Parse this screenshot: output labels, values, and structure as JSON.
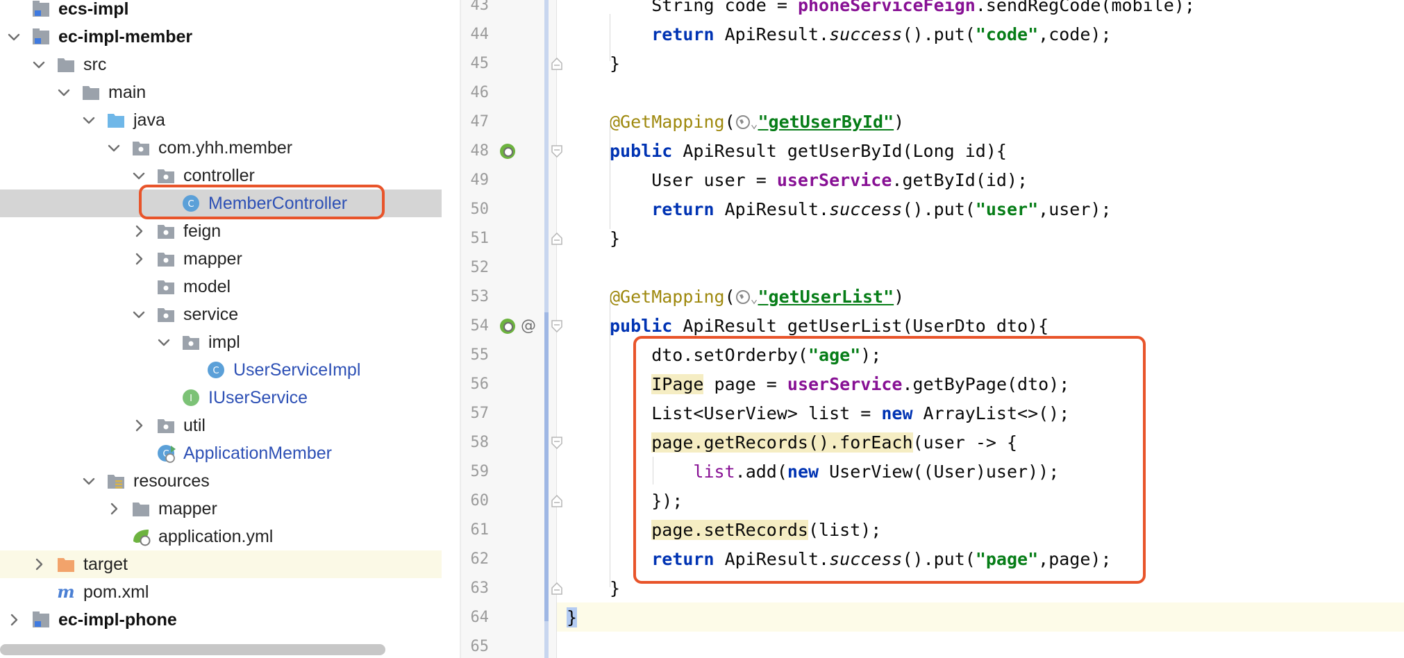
{
  "tree": {
    "items": [
      {
        "label": "ecs-impl",
        "style": "bold",
        "icon": "module-icon",
        "chevron": "none"
      },
      {
        "label": "ec-impl-member",
        "style": "bold",
        "icon": "module-icon",
        "chevron": "down"
      },
      {
        "label": "src",
        "style": "normal",
        "icon": "folder-icon",
        "chevron": "down"
      },
      {
        "label": "main",
        "style": "normal",
        "icon": "folder-icon",
        "chevron": "down"
      },
      {
        "label": "java",
        "style": "normal",
        "icon": "source-folder-icon",
        "chevron": "down"
      },
      {
        "label": "com.yhh.member",
        "style": "normal",
        "icon": "package-icon",
        "chevron": "down"
      },
      {
        "label": "controller",
        "style": "normal",
        "icon": "package-icon",
        "chevron": "down"
      },
      {
        "label": "MemberController",
        "style": "blue",
        "icon": "class-icon",
        "chevron": "none"
      },
      {
        "label": "feign",
        "style": "normal",
        "icon": "package-icon",
        "chevron": "right"
      },
      {
        "label": "mapper",
        "style": "normal",
        "icon": "package-icon",
        "chevron": "right"
      },
      {
        "label": "model",
        "style": "normal",
        "icon": "package-icon",
        "chevron": "none"
      },
      {
        "label": "service",
        "style": "normal",
        "icon": "package-icon",
        "chevron": "down"
      },
      {
        "label": "impl",
        "style": "normal",
        "icon": "package-icon",
        "chevron": "down"
      },
      {
        "label": "UserServiceImpl",
        "style": "blue",
        "icon": "class-icon",
        "chevron": "none"
      },
      {
        "label": "IUserService",
        "style": "blue",
        "icon": "interface-icon",
        "chevron": "none"
      },
      {
        "label": "util",
        "style": "normal",
        "icon": "package-icon",
        "chevron": "right"
      },
      {
        "label": "ApplicationMember",
        "style": "blue",
        "icon": "spring-boot-class-icon",
        "chevron": "none"
      },
      {
        "label": "resources",
        "style": "normal",
        "icon": "resources-folder-icon",
        "chevron": "down"
      },
      {
        "label": "mapper",
        "style": "normal",
        "icon": "folder-icon",
        "chevron": "right"
      },
      {
        "label": "application.yml",
        "style": "normal",
        "icon": "spring-config-icon",
        "chevron": "none"
      },
      {
        "label": "target",
        "style": "normal",
        "icon": "excluded-folder-icon",
        "chevron": "right"
      },
      {
        "label": "pom.xml",
        "style": "normal",
        "icon": "maven-icon",
        "chevron": "none"
      },
      {
        "label": "ec-impl-phone",
        "style": "bold",
        "icon": "module-icon",
        "chevron": "right"
      }
    ]
  },
  "editor": {
    "lines": [
      {
        "num": "43",
        "html": "    String code = <span class=\"fld\">phoneServiceFeign</span>.sendRegCode(mobile);"
      },
      {
        "num": "44",
        "html": "    <span class=\"kw\">return</span> ApiResult.<span class=\"ital\">success</span>().put(<span class=\"str\">\"code\"</span>,code);"
      },
      {
        "num": "45",
        "html": "}"
      },
      {
        "num": "46",
        "html": ""
      },
      {
        "num": "47",
        "html": "<span class=\"ann\">@GetMapping</span>(<svg class=\"globe\" data-name=\"url-globe-icon\" viewBox=\"0 0 22 22\"><circle cx=\"11\" cy=\"11\" r=\"9\" fill=\"none\" stroke=\"#8a8a8a\" stroke-width=\"2\"/><path d=\"M6 8 L10 7 L12 11 L9 14 Z\" fill=\"#8a8a8a\"/></svg><span style=\"color:#8a8a8a;font-size:18px\">⌄</span><span class=\"str ul\">\"getUserById\"</span>)"
      },
      {
        "num": "48",
        "html": "<span class=\"kw\">public</span> ApiResult getUserById(Long id){"
      },
      {
        "num": "49",
        "html": "    User user = <span class=\"fld\">userService</span>.getById(id);"
      },
      {
        "num": "50",
        "html": "    <span class=\"kw\">return</span> ApiResult.<span class=\"ital\">success</span>().put(<span class=\"str\">\"user\"</span>,user);"
      },
      {
        "num": "51",
        "html": "}"
      },
      {
        "num": "52",
        "html": ""
      },
      {
        "num": "53",
        "html": "<span class=\"ann\">@GetMapping</span>(<svg class=\"globe\" data-name=\"url-globe-icon\" viewBox=\"0 0 22 22\"><circle cx=\"11\" cy=\"11\" r=\"9\" fill=\"none\" stroke=\"#8a8a8a\" stroke-width=\"2\"/><path d=\"M6 8 L10 7 L12 11 L9 14 Z\" fill=\"#8a8a8a\"/></svg><span style=\"color:#8a8a8a;font-size:18px\">⌄</span><span class=\"str ul\">\"getUserList\"</span>)"
      },
      {
        "num": "54",
        "html": "<span class=\"kw\">public</span> ApiResult getUserList(UserDto dto){"
      },
      {
        "num": "55",
        "html": "    dto.setOrderby(<span class=\"str\">\"age\"</span>);"
      },
      {
        "num": "56",
        "html": "    <span class=\"hl-y\">IPage</span> page = <span class=\"fld\">userService</span>.getByPage(dto);"
      },
      {
        "num": "57",
        "html": "    List&lt;UserView&gt; list = <span class=\"kw\">new</span> ArrayList&lt;&gt;();"
      },
      {
        "num": "58",
        "html": "    <span class=\"hl-y\">page.getRecords().forEach</span>(user -&gt; {"
      },
      {
        "num": "59",
        "html": "        <span class=\"fld2\">list</span>.add(<span class=\"kw\">new</span> UserView((User)user));"
      },
      {
        "num": "60",
        "html": "    });"
      },
      {
        "num": "61",
        "html": "    <span class=\"hl-y\">page.setRecords</span>(list);"
      },
      {
        "num": "62",
        "html": "    <span class=\"kw\">return</span> ApiResult.<span class=\"ital\">success</span>().put(<span class=\"str\">\"page\"</span>,page);"
      },
      {
        "num": "63",
        "html": "}"
      },
      {
        "num": "64",
        "html": "<span class=\"caret-brace\">}</span>"
      },
      {
        "num": "65",
        "html": ""
      }
    ]
  },
  "colors": {
    "highlight_box": "#e8542a",
    "keyword": "#0033b3",
    "string": "#067d17",
    "field": "#871094",
    "annotation": "#9e880d"
  }
}
